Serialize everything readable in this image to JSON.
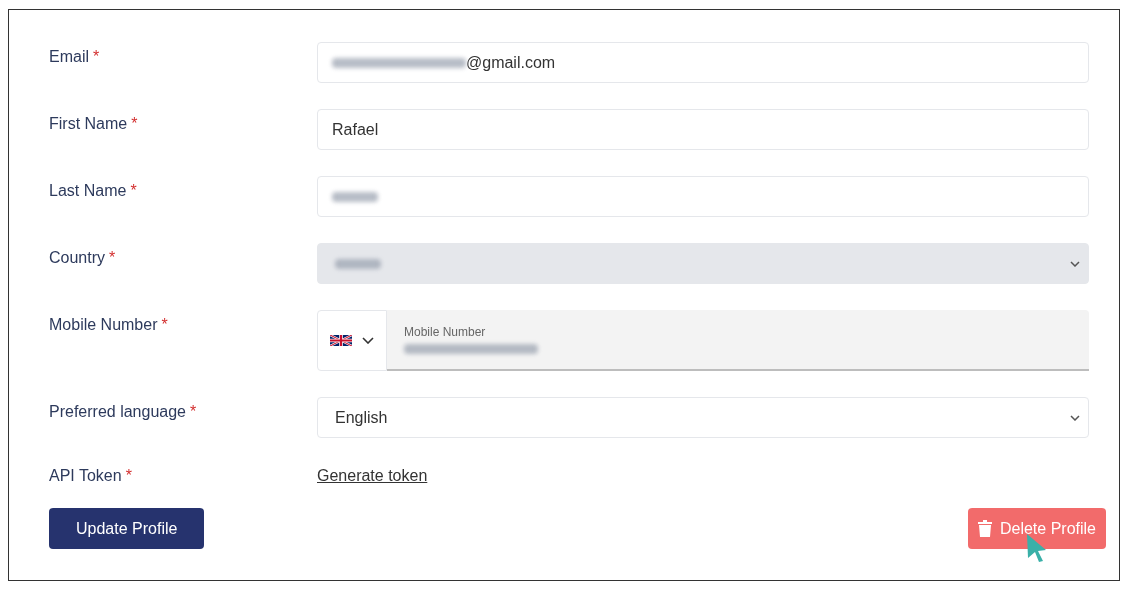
{
  "fields": [
    {
      "kind": "input",
      "label": "Email",
      "required_mark": "*",
      "value": "@gmail.com",
      "redacted": true
    },
    {
      "kind": "input",
      "label": "First Name",
      "required_mark": "*",
      "value": "Rafael",
      "redacted": false
    },
    {
      "kind": "input",
      "label": "Last Name",
      "required_mark": "*",
      "redacted": true
    },
    {
      "kind": "select",
      "label": "Country",
      "required_mark": "*",
      "redacted": true,
      "disabled": true
    },
    {
      "kind": "phone",
      "label": "Mobile Number",
      "required_mark": "*",
      "placeholder": "Mobile Number",
      "redacted": true
    },
    {
      "kind": "select",
      "label": "Preferred language",
      "required_mark": "*",
      "value": "English",
      "redacted": false
    },
    {
      "kind": "link",
      "label": "API Token",
      "required_mark": "*",
      "value": "Generate token"
    }
  ],
  "buttons": [
    {
      "kind": "primary",
      "label": "Update Profile"
    },
    {
      "kind": "danger",
      "label": "Delete Profile"
    }
  ]
}
